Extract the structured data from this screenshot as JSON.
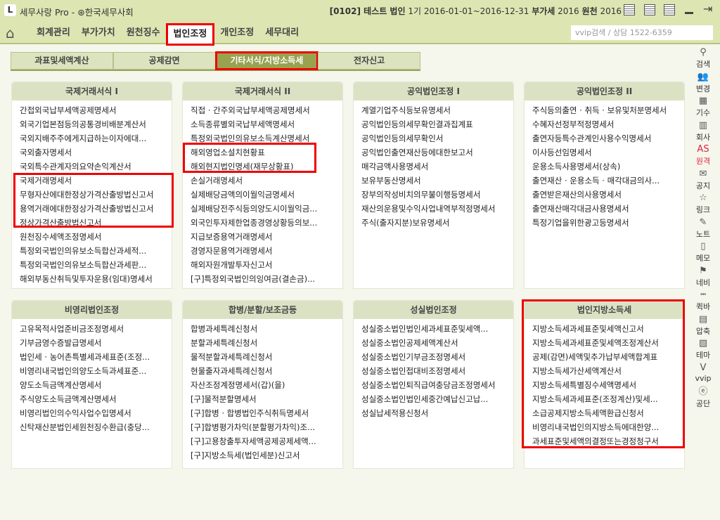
{
  "header": {
    "logo": "L",
    "app_title": "세무사랑 Pro - ⊛한국세무사회",
    "company_code": "[0102] 테스트 법인",
    "period": "1기 2016-01-01~2016-12-31",
    "vat_label": "부가세",
    "vat_year": "2016",
    "withholding_label": "원천",
    "withholding_year": "2016"
  },
  "menu": {
    "items": [
      "회계관리",
      "부가가치",
      "원천징수",
      "법인조정",
      "개인조정",
      "세무대리"
    ],
    "active": 3
  },
  "search": {
    "placeholder": "vvip검색 / 상담 1522-6359"
  },
  "subtabs": {
    "items": [
      "과표및세액계산",
      "공제감면",
      "기타서식/지방소득세",
      "전자신고"
    ],
    "active": 2
  },
  "panels": [
    {
      "title": "국제거래서식 I",
      "items": [
        "간접외국납부세액공제명세서",
        "외국기업본점등의공통경비배분계산서",
        "국외지배주주에게지급하는이자에대...",
        "국외출자명세서",
        "국외특수관계자의요약손익계산서",
        "국제거래명세서",
        "무형자산에대한정상가격산출방법신고서",
        "용역거래에대한정상가격산출방법신고서",
        "정상가격산출방법신고서",
        "원천징수세액조정명세서",
        "특정외국법인의유보소득합산과세적...",
        "특정외국법인의유보소득합산과세판...",
        "해외부동산취득및투자운용(임대)명세서"
      ]
    },
    {
      "title": "국제거래서식 II",
      "items": [
        "직접 · 간주외국납부세액공제명세서",
        "소득종류별외국납부세액명세서",
        "특정외국법인의유보소득계산명세서",
        "해외영업소설치현황표",
        "해외현지법인명세(재무상황표)",
        "손실거래명세서",
        "실제배당금액의이월익금명세서",
        "실제배당전주식등의양도시이월익금...",
        "외국인투자제한업종경영상황등의보...",
        "지급보증용역거래명세서",
        "경영자문용역거래명세서",
        "해외자원개발투자신고서",
        "[구]특정외국법인의잉여금(결손금)..."
      ]
    },
    {
      "title": "공익법인조정 I",
      "items": [
        "계열기업주식등보유명세서",
        "공익법인등의세무확인결과집계표",
        "공익법인등의세무확인서",
        "공익법인출연재산등에대한보고서",
        "매각금액사용명세서",
        "보유부동산명세서",
        "장부의작성비치의무불이행등명세서",
        "재산의운용및수익사업내역부적정명세서",
        "주식(출자지분)보유명세서"
      ]
    },
    {
      "title": "공익법인조정 II",
      "items": [
        "주식등의출연 · 취득 · 보유및처분명세서",
        "수혜자선정부적정명세서",
        "출연자등특수관계인사용수익명세서",
        "이사등선임명세서",
        "운용소득사용명세서(상속)",
        "출연재산 · 운용소득 · 매각대금의사...",
        "출연받은재산의사용명세서",
        "출연재산매각대금사용명세서",
        "특정기업을위한광고등명세서"
      ]
    },
    {
      "title": "비영리법인조정",
      "items": [
        "고유목적사업준비금조정명세서",
        "기부금영수증발급명세서",
        "법인세 · 농어촌특별세과세표준(조정...",
        "비영리내국법인의양도소득과세표준...",
        "양도소득금액계산명세서",
        "주식양도소득금액계산명세서",
        "비영리법인의수익사업수입명세서",
        "신탁재산분법인세원천징수환급(충당..."
      ]
    },
    {
      "title": "합병/분할/보조금등",
      "items": [
        "합병과세특례신청서",
        "분할과세특례신청서",
        "물적분할과세특례신청서",
        "현물출자과세특례신청서",
        "자산조정계정명세서(갑)(을)",
        "[구]물적분할명세서",
        "[구]합병 · 합병법인주식취득명세서",
        "[구]합병평가차익(분할평가차익)조...",
        "[구]고용창출투자세액공제공제세액...",
        "[구]지방소득세(법인세분)신고서"
      ]
    },
    {
      "title": "성실법인조정",
      "items": [
        "성실중소법인법인세과세표준및세액...",
        "성실중소법인공제세액계산서",
        "성실중소법인기부금조정명세서",
        "성실중소법인접대비조정명세서",
        "성실중소법인퇴직급여충당금조정명세서",
        "성실중소법인법인세중간예납신고납...",
        "성실납세적용신청서"
      ]
    },
    {
      "title": "법인지방소득세",
      "items": [
        "지방소득세과세표준및세액신고서",
        "지방소득세과세표준및세액조정계산서",
        "공제(감면)세액및추가납부세액합계표",
        "지방소득세가산세액계산서",
        "지방소득세특별징수세액명세서",
        "지방소득세과세표준(조정계산)및세...",
        "소급공제지방소득세액환급신청서",
        "비영리내국법인의지방소득에대한양...",
        "과세표준및세액의결정또는경정청구서"
      ]
    }
  ],
  "sidebar": [
    {
      "label": "검색",
      "icon": "search-icon",
      "glyph": "⚲"
    },
    {
      "label": "변경",
      "icon": "users-icon",
      "glyph": "👥"
    },
    {
      "label": "기수",
      "icon": "calendar-icon",
      "glyph": "▦"
    },
    {
      "label": "회사",
      "icon": "building-icon",
      "glyph": "▥"
    },
    {
      "label": "원격",
      "icon": "remote-icon",
      "glyph": "AS"
    },
    {
      "label": "공지",
      "icon": "notice-icon",
      "glyph": "✉"
    },
    {
      "label": "링크",
      "icon": "star-icon",
      "glyph": "☆"
    },
    {
      "label": "노트",
      "icon": "note-icon",
      "glyph": "✎"
    },
    {
      "label": "메모",
      "icon": "memo-icon",
      "glyph": "▯"
    },
    {
      "label": "네비",
      "icon": "navi-icon",
      "glyph": "⚑"
    },
    {
      "label": "퀵바",
      "icon": "quickbar-icon",
      "glyph": "┅"
    },
    {
      "label": "압축",
      "icon": "zip-icon",
      "glyph": "▤"
    },
    {
      "label": "테마",
      "icon": "theme-icon",
      "glyph": "▧"
    },
    {
      "label": "vvip",
      "icon": "vvip-icon",
      "glyph": "V"
    },
    {
      "label": "공단",
      "icon": "e-icon",
      "glyph": "ⓔ"
    }
  ],
  "colors": {
    "accent": "#98a24f",
    "highlight": "#ee0000",
    "header_bg": "#dde5b2"
  }
}
